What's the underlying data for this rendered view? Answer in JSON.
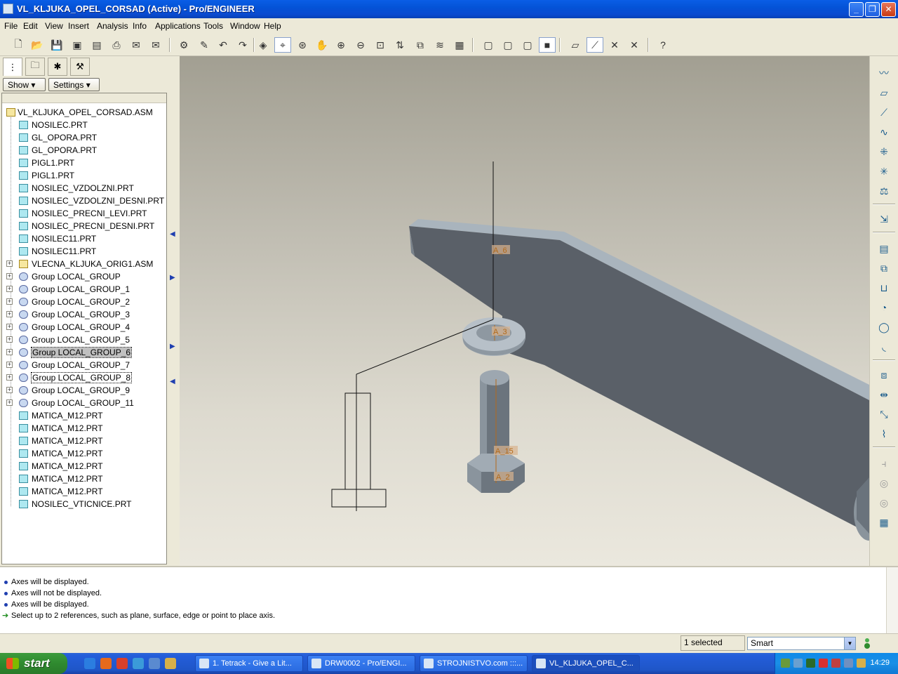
{
  "window": {
    "title": "VL_KLJUKA_OPEL_CORSAD (Active) - Pro/ENGINEER"
  },
  "menu": [
    "File",
    "Edit",
    "View",
    "Insert",
    "Analysis",
    "Info",
    "Applications",
    "Tools",
    "Window",
    "Help"
  ],
  "panel": {
    "show_label": "Show",
    "settings_label": "Settings"
  },
  "tree": {
    "root": "VL_KLJUKA_OPEL_CORSAD.ASM",
    "items": [
      {
        "label": "NOSILEC.PRT",
        "type": "part"
      },
      {
        "label": "GL_OPORA.PRT",
        "type": "part"
      },
      {
        "label": "GL_OPORA.PRT",
        "type": "part"
      },
      {
        "label": "PIGL1.PRT",
        "type": "part"
      },
      {
        "label": "PIGL1.PRT",
        "type": "part"
      },
      {
        "label": "NOSILEC_VZDOLZNI.PRT",
        "type": "part"
      },
      {
        "label": "NOSILEC_VZDOLZNI_DESNI.PRT",
        "type": "part"
      },
      {
        "label": "NOSILEC_PRECNI_LEVI.PRT",
        "type": "part"
      },
      {
        "label": "NOSILEC_PRECNI_DESNI.PRT",
        "type": "part"
      },
      {
        "label": "NOSILEC11.PRT",
        "type": "part"
      },
      {
        "label": "NOSILEC11.PRT",
        "type": "part"
      },
      {
        "label": "VLECNA_KLJUKA_ORIG1.ASM",
        "type": "asm"
      },
      {
        "label": "Group LOCAL_GROUP",
        "type": "group"
      },
      {
        "label": "Group LOCAL_GROUP_1",
        "type": "group"
      },
      {
        "label": "Group LOCAL_GROUP_2",
        "type": "group"
      },
      {
        "label": "Group LOCAL_GROUP_3",
        "type": "group"
      },
      {
        "label": "Group LOCAL_GROUP_4",
        "type": "group"
      },
      {
        "label": "Group LOCAL_GROUP_5",
        "type": "group"
      },
      {
        "label": "Group LOCAL_GROUP_6",
        "type": "group",
        "state": "selected"
      },
      {
        "label": "Group LOCAL_GROUP_7",
        "type": "group"
      },
      {
        "label": "Group LOCAL_GROUP_8",
        "type": "group",
        "state": "focus"
      },
      {
        "label": "Group LOCAL_GROUP_9",
        "type": "group"
      },
      {
        "label": "Group LOCAL_GROUP_11",
        "type": "group"
      },
      {
        "label": "MATICA_M12.PRT",
        "type": "part"
      },
      {
        "label": "MATICA_M12.PRT",
        "type": "part"
      },
      {
        "label": "MATICA_M12.PRT",
        "type": "part"
      },
      {
        "label": "MATICA_M12.PRT",
        "type": "part"
      },
      {
        "label": "MATICA_M12.PRT",
        "type": "part"
      },
      {
        "label": "MATICA_M12.PRT",
        "type": "part"
      },
      {
        "label": "MATICA_M12.PRT",
        "type": "part"
      },
      {
        "label": "NOSILEC_VTICNICE.PRT",
        "type": "part"
      }
    ]
  },
  "viewport": {
    "axes": [
      "A_6",
      "A_3",
      "A_15",
      "A_2"
    ]
  },
  "messages": [
    {
      "text": "Axes will be displayed.",
      "kind": "info"
    },
    {
      "text": "Axes will not be displayed.",
      "kind": "info"
    },
    {
      "text": "Axes will be displayed.",
      "kind": "info"
    },
    {
      "text": "Select up to 2 references, such as plane, surface, edge or point to place axis.",
      "kind": "prompt"
    }
  ],
  "status": {
    "selection": "1 selected",
    "filter": "Smart"
  },
  "taskbar": {
    "start": "start",
    "tasks": [
      "1. Tetrack - Give a Lit...",
      "DRW0002 - Pro/ENGI...",
      "STROJNISTVO.com :::...",
      "VL_KLJUKA_OPEL_C..."
    ],
    "clock": "14:29"
  },
  "colors": {
    "title_bar": "#0453d7",
    "viewport_top": "#a29f92",
    "model_gray": "#5a6068",
    "model_edge": "#a9b4bd",
    "axis_label": "#b36a1a"
  }
}
